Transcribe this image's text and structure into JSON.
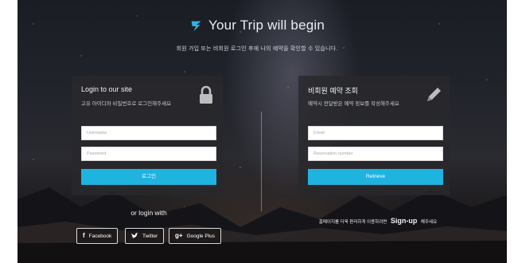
{
  "header": {
    "brand_title": "Your Trip will begin",
    "subtitle": "회원 가입 또는 비회원 로그인 후에 나의 예약을 확인할 수 있습니다."
  },
  "login_panel": {
    "title": "Login to our site",
    "description": "고유 아이디와 비밀번호로 로그인해주세요",
    "username_placeholder": "Username",
    "password_placeholder": "Password",
    "login_button": "로그인"
  },
  "guest_panel": {
    "title": "비회원 예약 조회",
    "description": "예약시 전달받은 예약 정보를 작성해주세요",
    "email_placeholder": "Email",
    "reservation_placeholder": "Reservation number",
    "retrieve_button": "Retrieve"
  },
  "social": {
    "heading": "or login with",
    "buttons": [
      {
        "label": "Facebook",
        "icon": "facebook-icon",
        "glyph": "f"
      },
      {
        "label": "Twitter",
        "icon": "twitter-icon",
        "glyph": "🐦"
      },
      {
        "label": "Google Plus",
        "icon": "google-plus-icon",
        "glyph": "g+"
      }
    ]
  },
  "signup": {
    "prefix": "홈페이지를 더욱 편리하게 이용하려면",
    "link": "Sign-up",
    "suffix": "해주세요"
  },
  "colors": {
    "accent": "#1fb3e0",
    "panel_bg": "#28282c"
  }
}
